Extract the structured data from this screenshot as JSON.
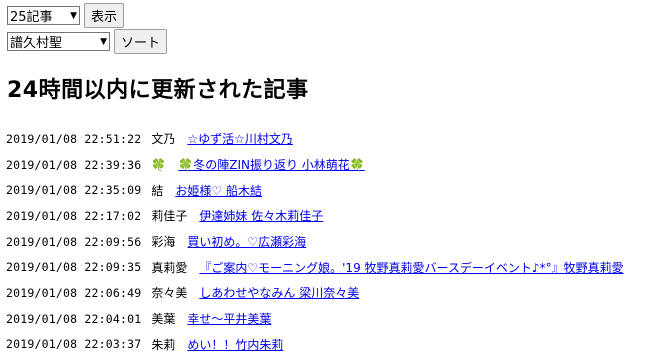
{
  "controls": {
    "count_select": "25記事",
    "show_button": "表示",
    "sort_select": "譜久村聖",
    "sort_button": "ソート"
  },
  "heading": "24時間以内に更新された記事",
  "articles": [
    {
      "time": "2019/01/08 22:51:22",
      "author": "文乃",
      "title": "☆ゆず活☆川村文乃"
    },
    {
      "time": "2019/01/08 22:39:36",
      "author": "🍀",
      "title": "🍀冬の陣ZIN振り返り 小林萌花🍀"
    },
    {
      "time": "2019/01/08 22:35:09",
      "author": "結",
      "title": "お姫様♡ 船木結"
    },
    {
      "time": "2019/01/08 22:17:02",
      "author": "莉佳子",
      "title": "伊達姉妹 佐々木莉佳子"
    },
    {
      "time": "2019/01/08 22:09:56",
      "author": "彩海",
      "title": "買い初め。♡広瀬彩海"
    },
    {
      "time": "2019/01/08 22:09:35",
      "author": "真莉愛",
      "title": "『ご案内♡モーニング娘。'19 牧野真莉愛バースデーイベント♪*°』牧野真莉愛"
    },
    {
      "time": "2019/01/08 22:06:49",
      "author": "奈々美",
      "title": "しあわせやなみん 梁川奈々美"
    },
    {
      "time": "2019/01/08 22:04:01",
      "author": "美葉",
      "title": "幸せ〜平井美葉"
    },
    {
      "time": "2019/01/08 22:03:37",
      "author": "朱莉",
      "title": "めい！！竹内朱莉"
    }
  ]
}
